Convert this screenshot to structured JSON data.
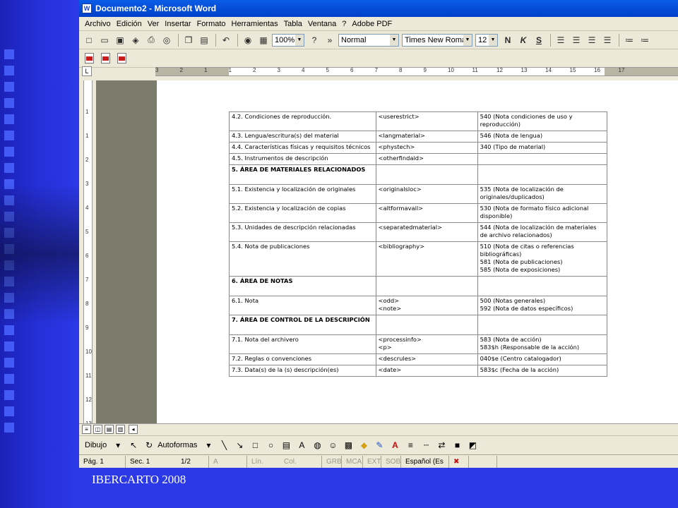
{
  "window": {
    "title": "Documento2 - Microsoft Word",
    "icon": "word-doc-icon"
  },
  "menu": [
    "Archivo",
    "Edición",
    "Ver",
    "Insertar",
    "Formato",
    "Herramientas",
    "Tabla",
    "Ventana",
    "?",
    "Adobe PDF"
  ],
  "toolbar": {
    "zoom": "100%",
    "style": "Normal",
    "font": "Times New Roman",
    "size": "12",
    "bold": "N",
    "italic": "K",
    "underline": "S"
  },
  "ruler": {
    "corner": "L",
    "h_ticks": [
      "3",
      "2",
      "1",
      "1",
      "2",
      "3",
      "4",
      "5",
      "6",
      "7",
      "8",
      "9",
      "10",
      "11",
      "12",
      "13",
      "14",
      "15",
      "16",
      "17"
    ],
    "v_ticks": [
      "1",
      "1",
      "2",
      "3",
      "4",
      "5",
      "6",
      "7",
      "8",
      "9",
      "10",
      "11",
      "12",
      "13"
    ]
  },
  "table": [
    {
      "c1": "4.2. Condiciones de reproducción.",
      "c2": "<userestrict>",
      "c3": "540 (Nota condiciones de uso y reproducción)",
      "hdr": false
    },
    {
      "c1": "4.3. Lengua/escritura(s) del material",
      "c2": "<langmaterial>",
      "c3": "546 (Nota de lengua)",
      "hdr": false
    },
    {
      "c1": "4.4. Características físicas y requisitos técnicos",
      "c2": "<phystech>",
      "c3": "340 (Tipo de material)",
      "hdr": false
    },
    {
      "c1": "4.5. Instrumentos de descripción",
      "c2": "<otherfindaid>",
      "c3": "",
      "hdr": false
    },
    {
      "c1": "5. ÁREA DE MATERIALES RELACIONADOS",
      "c2": "",
      "c3": "",
      "hdr": true
    },
    {
      "c1": "5.1. Existencia y localización de originales",
      "c2": "<originalsloc>",
      "c3": "535 (Nota de localización de originales/duplicados)",
      "hdr": false
    },
    {
      "c1": "5.2. Existencia y localización de copias",
      "c2": "<altformavail>",
      "c3": "530 (Nota de formato físico adicional disponible)",
      "hdr": false
    },
    {
      "c1": "5.3. Unidades de descripción relacionadas",
      "c2": "<separatedmaterial>",
      "c3": "544 (Nota de localización de materiales de archivo relacionados)",
      "hdr": false
    },
    {
      "c1": "5.4. Nota de publicaciones",
      "c2": "<bibliography>",
      "c3": "510 (Nota de citas o referencias bibliográficas)\n581 (Nota de publicaciones)\n585 (Nota de exposiciones)",
      "hdr": false
    },
    {
      "c1": "6. ÁREA DE NOTAS",
      "c2": "",
      "c3": "",
      "hdr": true
    },
    {
      "c1": "6.1. Nota",
      "c2": "<odd>\n<note>",
      "c3": "500 (Notas generales)\n592 (Nota de datos específicos)",
      "hdr": false
    },
    {
      "c1": "7. ÁREA DE CONTROL DE LA DESCRIPCIÓN",
      "c2": "",
      "c3": "",
      "hdr": true
    },
    {
      "c1": "7.1. Nota del archivero",
      "c2": "<processinfo>\n<p>",
      "c3": "583 (Nota de acción)\n583$h (Responsable de la acción)",
      "hdr": false
    },
    {
      "c1": "7.2. Reglas o convenciones",
      "c2": "<descrules>",
      "c3": "040$e (Centro catalogador)",
      "hdr": false
    },
    {
      "c1": "7.3. Data(s) de la (s) descripción(es)",
      "c2": "<date>",
      "c3": "583$c (Fecha de la acción)",
      "hdr": false
    }
  ],
  "drawing": {
    "dibujo": "Dibujo",
    "autoformas": "Autoformas"
  },
  "status": {
    "page": "Pág. 1",
    "section": "Sec. 1",
    "pages": "1/2",
    "at": "A",
    "line": "Lín.",
    "col": "Col.",
    "grb": "GRB",
    "mca": "MCA",
    "ext": "EXT",
    "sob": "SOB",
    "language": "Español (Es"
  },
  "caption": "IBERCARTO 2008",
  "colors": {
    "slide_bg": "#2b39e8",
    "titlebar": "#0a5ce6",
    "window_bg": "#ece9d8"
  }
}
